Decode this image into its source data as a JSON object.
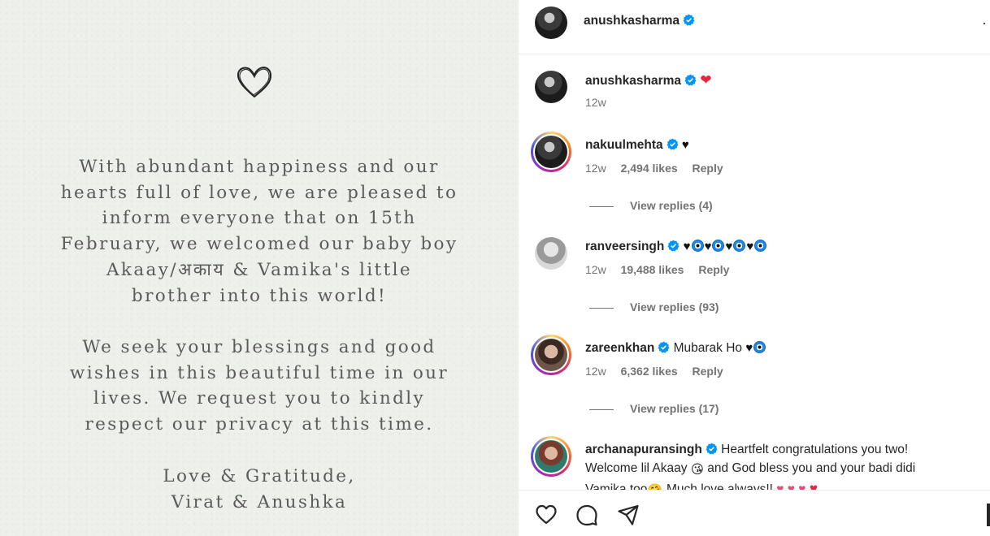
{
  "post": {
    "paragraph1": [
      "With abundant happiness and our",
      "hearts full of love, we are pleased to",
      "inform everyone that on 15th",
      "February, we welcomed our baby boy",
      "Akaay/अकाय & Vamika's little",
      "brother into this world!"
    ],
    "paragraph2": [
      "We seek your blessings and good",
      "wishes in this beautiful time in our",
      "lives. We request you to kindly",
      "respect our privacy at this time."
    ],
    "paragraph3": [
      "Love & Gratitude,",
      "Virat & Anushka"
    ]
  },
  "header": {
    "username": "anushkasharma",
    "more": "·"
  },
  "caption": {
    "username": "anushkasharma",
    "text": "❤",
    "time": "12w"
  },
  "comments": [
    {
      "username": "nakuulmehta",
      "text": "♥",
      "time": "12w",
      "likes": "2,494 likes",
      "reply": "Reply",
      "view_replies": "View replies (4)"
    },
    {
      "username": "ranveersingh",
      "text": "",
      "time": "12w",
      "likes": "19,488 likes",
      "reply": "Reply",
      "view_replies": "View replies (93)"
    },
    {
      "username": "zareenkhan",
      "text": "Mubarak Ho",
      "time": "12w",
      "likes": "6,362 likes",
      "reply": "Reply",
      "view_replies": "View replies (17)"
    },
    {
      "username": "archanapuransingh",
      "text1": "Heartfelt congratulations you two!",
      "text2a": "Welcome lil Akaay",
      "text2b": "and God bless you and your badi didi",
      "text3a": "Vamika too",
      "text3b": "Much love always!!"
    }
  ],
  "colors": {
    "verified": "#0095f6",
    "red_heart": "#e8243c",
    "secondary_text": "#737373"
  },
  "icons": {
    "like": "heart-outline-icon",
    "comment": "speech-bubble-icon",
    "share": "paper-plane-icon"
  }
}
